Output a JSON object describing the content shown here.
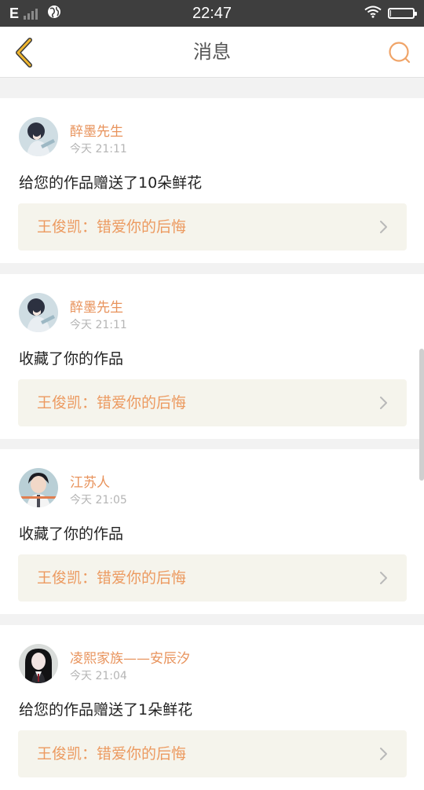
{
  "status_bar": {
    "network_type": "E",
    "time": "22:47",
    "battery_level_fraction": 0.05,
    "icons": [
      "signal-icon",
      "browser-icon",
      "wifi-icon",
      "battery-icon"
    ]
  },
  "nav": {
    "title": "消息",
    "back_icon": "chevron-left-icon",
    "search_icon": "search-icon",
    "accent_color": "#e8a838"
  },
  "colors": {
    "name": "#e8935c",
    "link_text": "#ec9a60",
    "link_bg": "#f5f4ec",
    "time": "#b5b5b5"
  },
  "messages": [
    {
      "user": "醉墨先生",
      "time": "今天 21:11",
      "text": "给您的作品赠送了10朵鲜花",
      "work": "王俊凯：错爱你的后悔"
    },
    {
      "user": "醉墨先生",
      "time": "今天 21:11",
      "text": "收藏了你的作品",
      "work": "王俊凯：错爱你的后悔"
    },
    {
      "user": "江苏人",
      "time": "今天 21:05",
      "text": "收藏了你的作品",
      "work": "王俊凯：错爱你的后悔"
    },
    {
      "user": "凌熙家族——安辰汐",
      "time": "今天 21:04",
      "text": "给您的作品赠送了1朵鲜花",
      "work": "王俊凯：错爱你的后悔"
    }
  ]
}
